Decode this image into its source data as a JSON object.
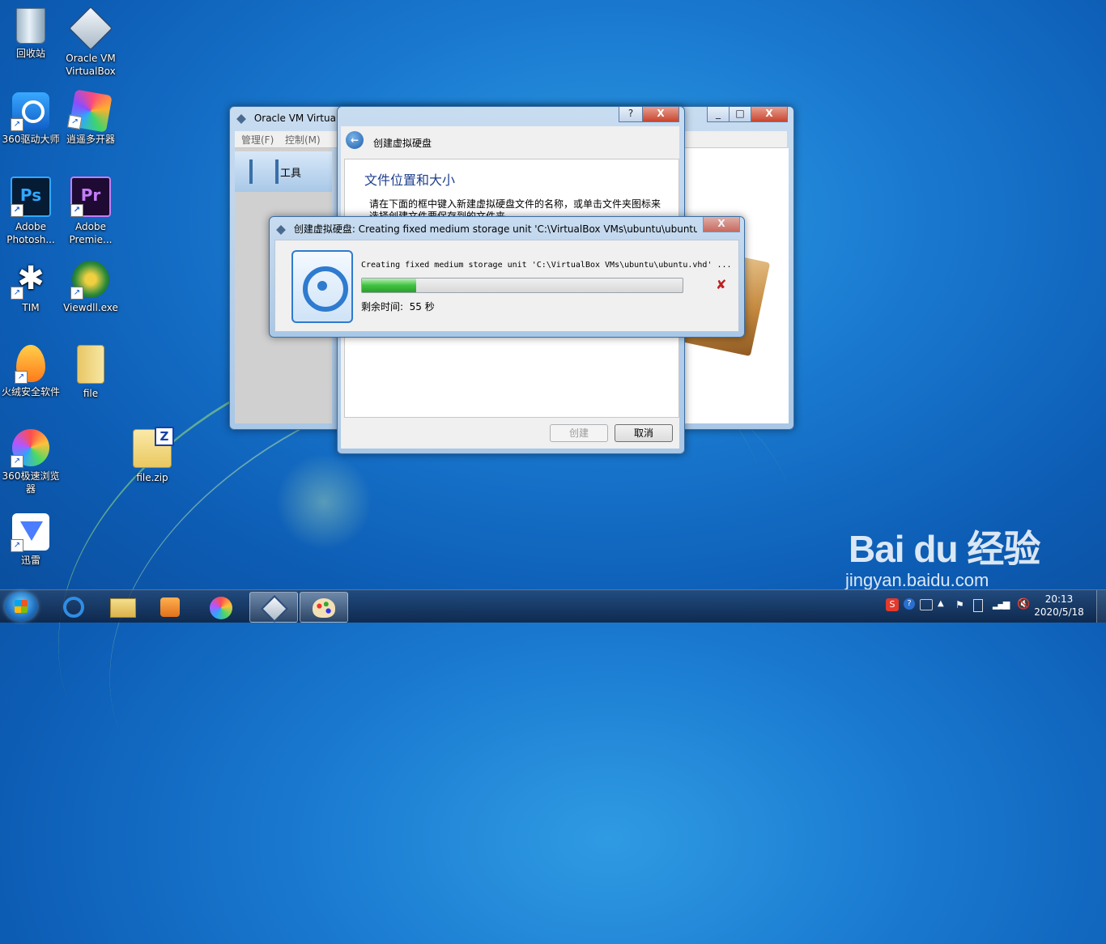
{
  "desktop": {
    "icons": [
      {
        "label": "回收站"
      },
      {
        "label": "Oracle VM VirtualBox"
      },
      {
        "label": "360驱动大师"
      },
      {
        "label": "逍遥多开器"
      },
      {
        "label": "Adobe Photosh..."
      },
      {
        "label": "Adobe Premie..."
      },
      {
        "label": "TIM"
      },
      {
        "label": "Viewdll.exe"
      },
      {
        "label": "火绒安全软件"
      },
      {
        "label": "file"
      },
      {
        "label": "360极速浏览器"
      },
      {
        "label": "file.zip"
      },
      {
        "label": "迅雷"
      }
    ]
  },
  "main_window": {
    "title": "Oracle VM VirtualBox 管理器",
    "menu": [
      "管理(F)",
      "控制(M)"
    ],
    "tools_label": "工具"
  },
  "wizard": {
    "title": "创建虚拟硬盘",
    "heading": "文件位置和大小",
    "description": "请在下面的框中键入新建虚拟硬盘文件的名称，或单击文件夹图标来选择创建文件要保存到的文件夹。",
    "create_label": "创建",
    "cancel_label": "取消",
    "help_label": "?",
    "close_label": "X"
  },
  "progress_dialog": {
    "title": "创建虚拟硬盘: Creating fixed medium storage unit 'C:\\VirtualBox VMs\\ubuntu\\ubuntu....",
    "message": "Creating fixed medium storage unit 'C:\\VirtualBox VMs\\ubuntu\\ubuntu.vhd' ...",
    "progress": 0.17,
    "remaining": "剩余时间:  55 秒",
    "close_label": "X"
  },
  "taskbar": {
    "time": "20:13",
    "date": "2020/5/18"
  },
  "watermark": {
    "brand": "Bai du 经验",
    "url": "jingyan.baidu.com"
  },
  "colors": {
    "accent": "#1a7ad0",
    "progress": "#3fc23f",
    "cancel_x": "#c02020"
  }
}
